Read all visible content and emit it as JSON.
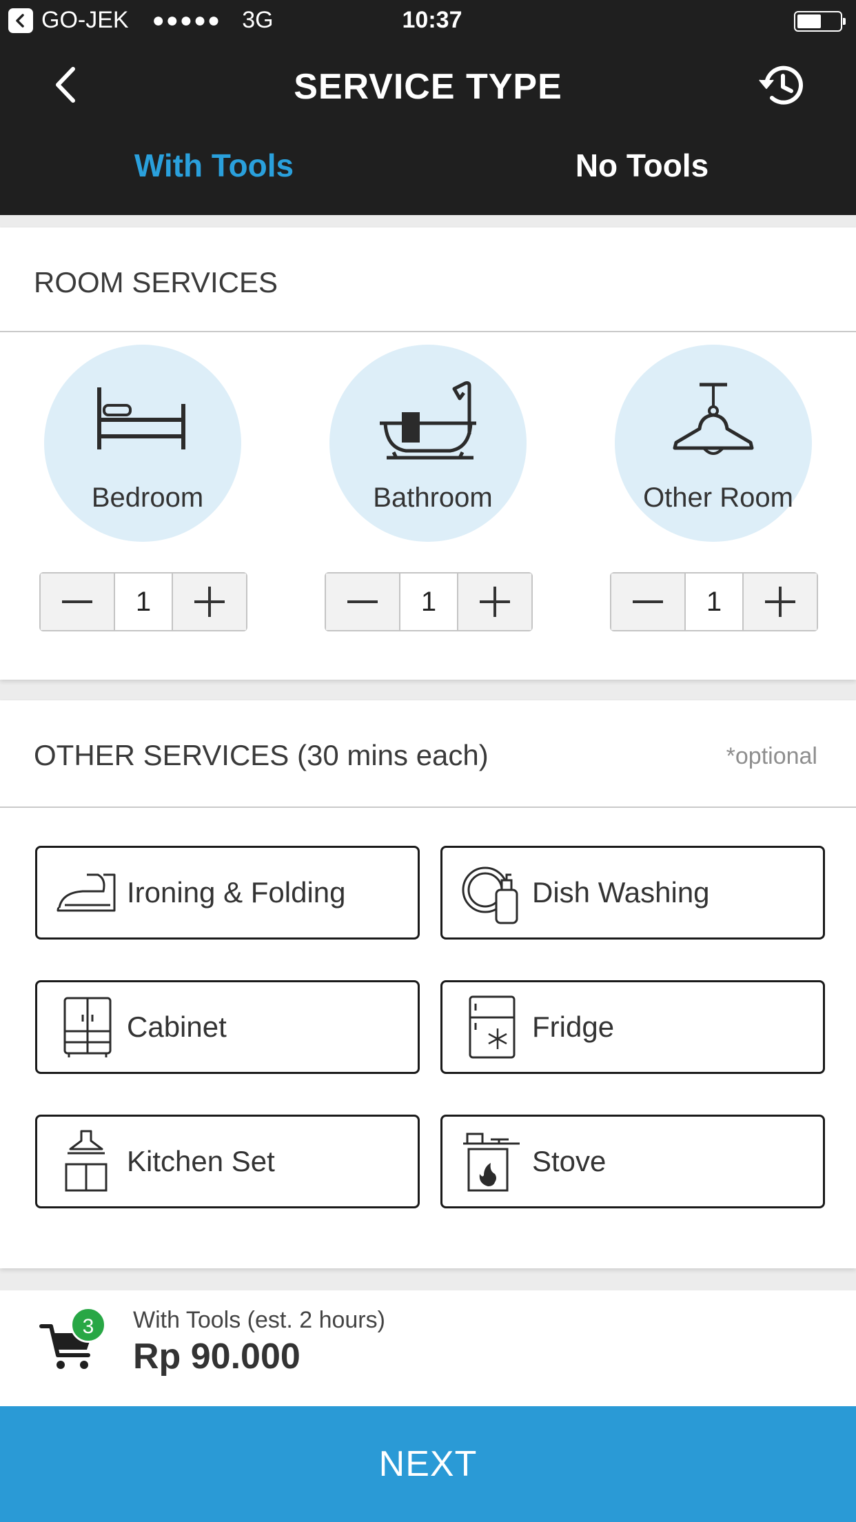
{
  "status_bar": {
    "carrier": "GO-JEK",
    "signal": "●●●●●",
    "network": "3G",
    "time": "10:37",
    "battery_level": 0.5
  },
  "header": {
    "title": "SERVICE TYPE",
    "back_icon": "chevron-left-icon",
    "history_icon": "history-icon"
  },
  "tabs": [
    {
      "label": "With Tools",
      "active": true
    },
    {
      "label": "No Tools",
      "active": false
    }
  ],
  "room_services": {
    "title": "ROOM SERVICES",
    "rooms": [
      {
        "label": "Bedroom",
        "icon": "bed-icon",
        "count": "1"
      },
      {
        "label": "Bathroom",
        "icon": "bathtub-icon",
        "count": "1"
      },
      {
        "label": "Other Room",
        "icon": "ceiling-lamp-icon",
        "count": "1"
      }
    ]
  },
  "other_services": {
    "title": "OTHER SERVICES (30 mins each)",
    "optional": "*optional",
    "items": [
      {
        "label": "Ironing & Folding",
        "icon": "iron-icon"
      },
      {
        "label": "Dish Washing",
        "icon": "dish-soap-icon"
      },
      {
        "label": "Cabinet",
        "icon": "cabinet-icon"
      },
      {
        "label": "Fridge",
        "icon": "fridge-icon"
      },
      {
        "label": "Kitchen Set",
        "icon": "kitchen-hood-icon"
      },
      {
        "label": "Stove",
        "icon": "stove-icon"
      }
    ]
  },
  "footer": {
    "cart_count": "3",
    "estimate": "With Tools (est. 2 hours)",
    "price": "Rp 90.000",
    "next_label": "NEXT"
  },
  "colors": {
    "header_bg": "#1f1f1f",
    "accent": "#2aa0dc",
    "next_bg": "#2a9ad6",
    "room_circle": "#ddeef8",
    "badge": "#28a745"
  }
}
